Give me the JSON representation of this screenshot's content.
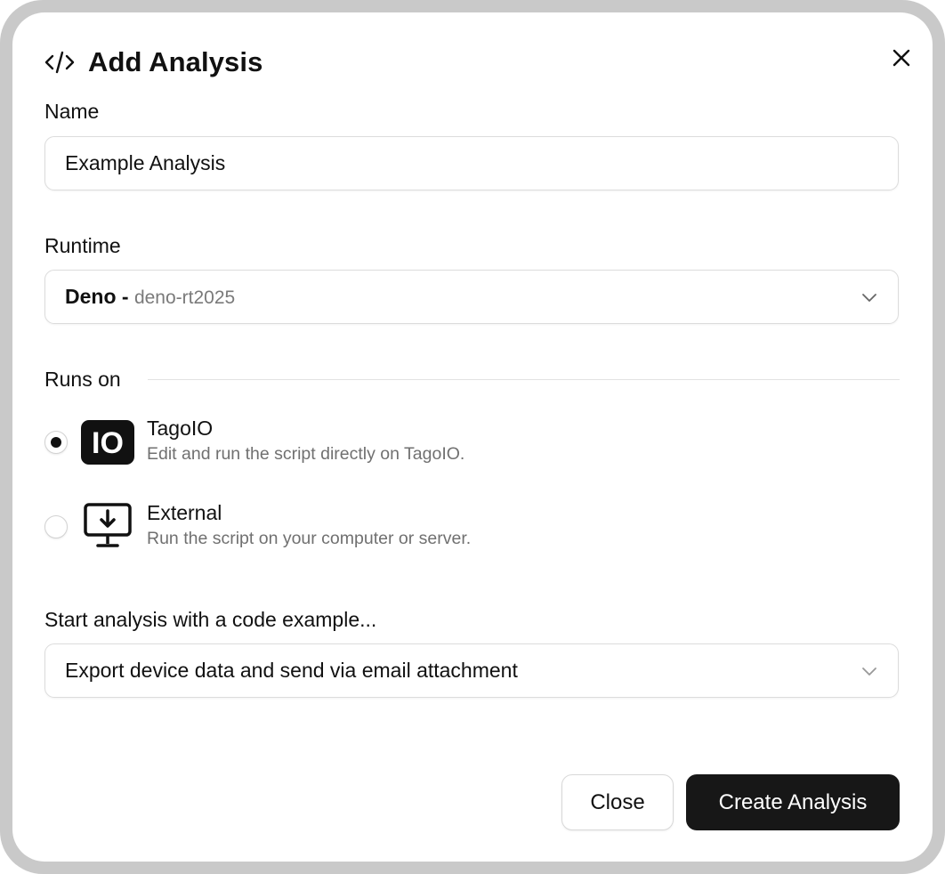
{
  "dialog": {
    "title": "Add Analysis",
    "title_icon": "code-icon",
    "close_icon": "close-icon"
  },
  "name_field": {
    "label": "Name",
    "value": "Example Analysis"
  },
  "runtime": {
    "label": "Runtime",
    "selected_name": "Deno -",
    "selected_id": "deno-rt2025"
  },
  "runs_on": {
    "label": "Runs on",
    "options": [
      {
        "title": "TagoIO",
        "description": "Edit and run the script directly on TagoIO.",
        "icon": "tagoio-logo-icon",
        "logo_text": "IO",
        "selected": true
      },
      {
        "title": "External",
        "description": "Run the script on your computer or server.",
        "icon": "monitor-download-icon",
        "selected": false
      }
    ]
  },
  "code_example": {
    "label": "Start analysis with a code example...",
    "selected": "Export device data and send via email attachment"
  },
  "footer": {
    "close_label": "Close",
    "create_label": "Create Analysis"
  },
  "colors": {
    "primary_button": "#171717",
    "outer_frame": "#c9c9c9",
    "muted_text": "#707070"
  }
}
